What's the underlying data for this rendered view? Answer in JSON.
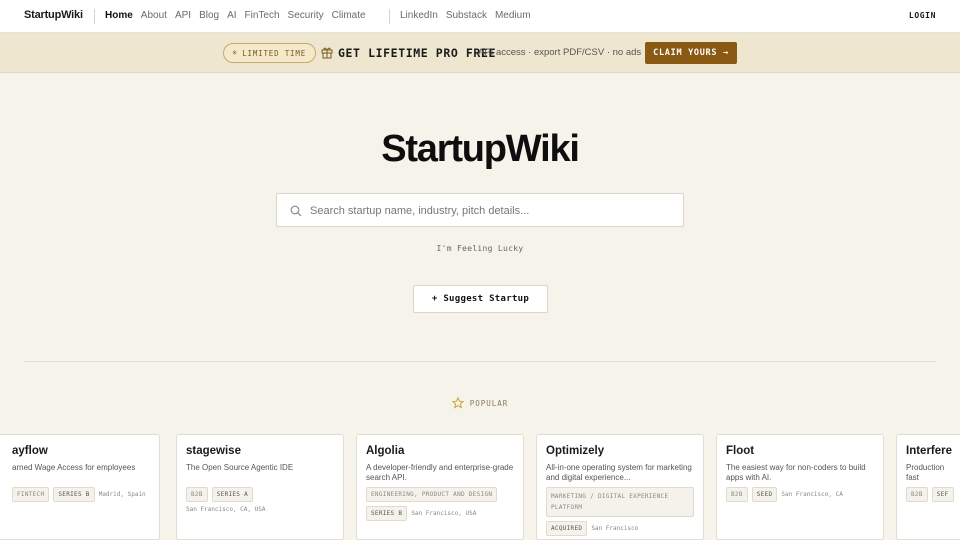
{
  "nav": {
    "brand": "StartupWiki",
    "links": [
      "Home",
      "About",
      "API",
      "Blog",
      "AI",
      "FinTech",
      "Security",
      "Climate"
    ],
    "active": "Home",
    "social": [
      "LinkedIn",
      "Substack",
      "Medium"
    ],
    "login": "LOGIN"
  },
  "promo": {
    "pill": "LIMITED TIME",
    "headline": "GET LIFETIME PRO FREE",
    "sub": "API access · export PDF/CSV · no ads",
    "cta": "CLAIM YOURS →"
  },
  "hero": {
    "logo": "StartupWiki",
    "search_placeholder": "Search startup name, industry, pitch details...",
    "lucky": "I'm Feeling Lucky",
    "suggest": "+ Suggest Startup"
  },
  "popular": {
    "label": "POPULAR"
  },
  "cards": [
    {
      "name": "ayflow",
      "desc": "arned Wage Access for employees",
      "tags": [
        "FINTECH",
        "SERIES B"
      ],
      "location": "Madrid, Spain"
    },
    {
      "name": "stagewise",
      "desc": "The Open Source Agentic IDE",
      "tags": [
        "B2B",
        "SERIES A"
      ],
      "location": "San Francisco, CA, USA"
    },
    {
      "name": "Algolia",
      "desc": "A developer-friendly and enterprise-grade search API.",
      "industry": "ENGINEERING, PRODUCT AND DESIGN",
      "tags": [
        "SERIES B"
      ],
      "location": "San Francisco, USA"
    },
    {
      "name": "Optimizely",
      "desc": "All-in-one operating system for marketing and digital experience...",
      "industry": "MARKETING / DIGITAL EXPERIENCE PLATFORM",
      "tags": [
        "ACQUIRED"
      ],
      "location": "San Francisco"
    },
    {
      "name": "Floot",
      "desc": "The easiest way for non-coders to build apps with AI.",
      "tags": [
        "B2B",
        "SEED"
      ],
      "location": "San Francisco, CA"
    },
    {
      "name": "Interfere",
      "desc": "Production fast",
      "tags": [
        "B2B",
        "SEF"
      ],
      "location": ""
    }
  ],
  "colors": {
    "accent": "#8a5a14",
    "background": "#f6f3ea",
    "banner": "#efe6d0"
  }
}
